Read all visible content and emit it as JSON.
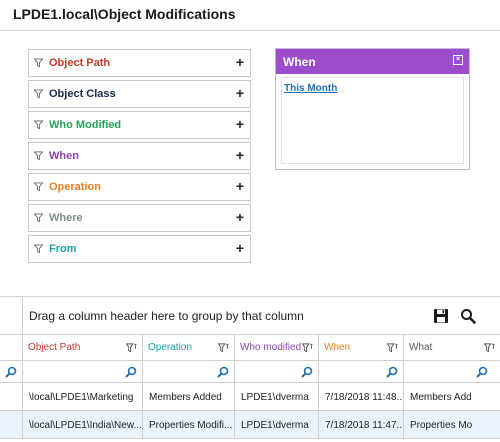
{
  "page": {
    "title": "LPDE1.local\\Object Modifications"
  },
  "filters": [
    {
      "label": "Object Path",
      "color": "#c0392b"
    },
    {
      "label": "Object Class",
      "color": "#1a2b4a"
    },
    {
      "label": "Who Modified",
      "color": "#27a05a"
    },
    {
      "label": "When",
      "color": "#8e44ad"
    },
    {
      "label": "Operation",
      "color": "#e67e22"
    },
    {
      "label": "Where",
      "color": "#7f8c8d"
    },
    {
      "label": "From",
      "color": "#16a5a5"
    }
  ],
  "when_panel": {
    "title": "When",
    "link": "This Month"
  },
  "grid": {
    "group_hint": "Drag a column header here to group by that column",
    "columns": [
      {
        "label": "Object Path",
        "color": "#c0392b"
      },
      {
        "label": "Operation",
        "color": "#16a5a5"
      },
      {
        "label": "Who modified",
        "color": "#8e44ad"
      },
      {
        "label": "When",
        "color": "#e67e22"
      },
      {
        "label": "What",
        "color": "#555555"
      }
    ],
    "rows": [
      [
        "\\local\\LPDE1\\Marketing",
        "Members Added",
        "LPDE1\\dverma",
        "7/18/2018 11:48...",
        "Members Add"
      ],
      [
        "\\local\\LPDE1\\India\\New...",
        "Properties Modifi...",
        "LPDE1\\dverma",
        "7/18/2018 11:47...",
        "Properties Mo"
      ]
    ]
  }
}
